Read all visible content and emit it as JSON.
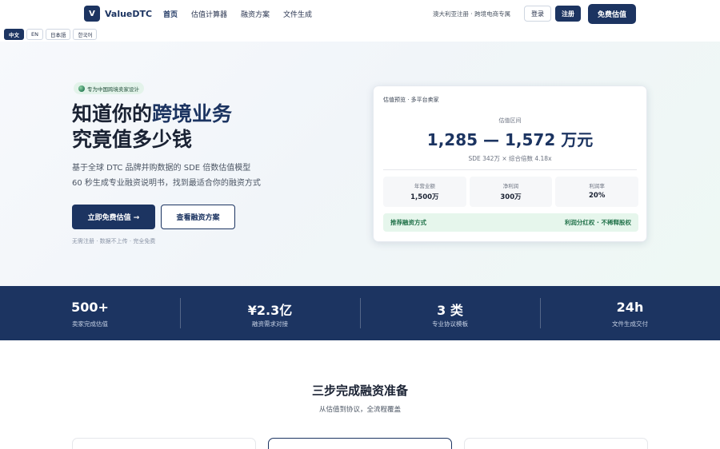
{
  "header": {
    "logo_mark": "V",
    "logo_text": "ValueDTC",
    "nav": [
      "首页",
      "估值计算器",
      "融资方案",
      "文件生成"
    ],
    "note": "澳大利亚注册 · 跨境电商专属",
    "login": "登录",
    "register": "注册",
    "cta": "免费估值"
  },
  "languages": [
    "中文",
    "EN",
    "日本語",
    "한국어"
  ],
  "hero": {
    "badge": "专为中国跨境卖家设计",
    "title_line1_a": "知道你的",
    "title_line1_b": "跨境业务",
    "title_line2": "究竟值多少钱",
    "sub_line1": "基于全球 DTC 品牌并购数据的 SDE 倍数估值模型",
    "sub_line2": "60 秒生成专业融资说明书，找到最适合你的融资方式",
    "primary_button": "立即免费估值 →",
    "secondary_button": "查看融资方案",
    "note": "无需注册 · 数据不上传 · 完全免费"
  },
  "card": {
    "header": "估值预览 · 多平台卖家",
    "range_label": "估值区间",
    "range": "1,285 — 1,572 万元",
    "sde": "SDE 342万 × 综合倍数 4.18x",
    "metrics": [
      {
        "label": "年营业额",
        "value": "1,500万"
      },
      {
        "label": "净利润",
        "value": "300万"
      },
      {
        "label": "利润率",
        "value": "20%"
      }
    ],
    "rec_label": "推荐融资方式",
    "rec_value": "利润分红权 · 不稀释股权"
  },
  "stats": [
    {
      "value": "500+",
      "label": "卖家完成估值"
    },
    {
      "value": "¥2.3亿",
      "label": "融资需求对接"
    },
    {
      "value": "3 类",
      "label": "专业协议模板"
    },
    {
      "value": "24h",
      "label": "文件生成交付"
    }
  ],
  "steps": {
    "title": "三步完成融资准备",
    "subtitle": "从估值到协议，全流程覆盖"
  },
  "colors": {
    "brand": "#1c3461",
    "accent_green": "#23734b",
    "badge_bg": "#e3f3ea"
  }
}
